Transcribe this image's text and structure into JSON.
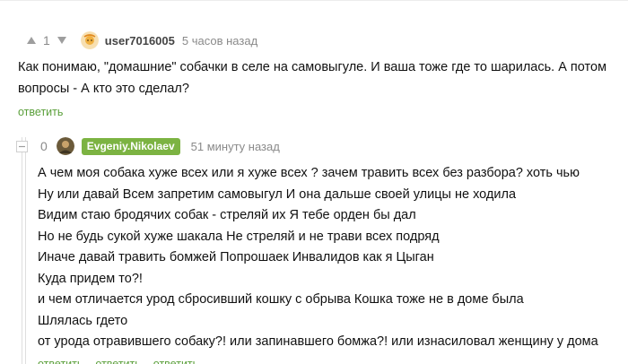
{
  "comment1": {
    "score": "1",
    "username": "user7016005",
    "time": "5 часов назад",
    "lines": [
      "Как понимаю, \"домашние\" собачки в селе на самовыгуле. И ваша тоже где то шарилась. А потом",
      "вопросы - А кто это сделал?"
    ],
    "reply_label": "ответить"
  },
  "comment2": {
    "score": "0",
    "username": "Evgeniy.Nikolaev",
    "time": "51 минуту назад",
    "lines": [
      "А чем моя собака хуже всех или я хуже всех ? зачем травить всех без разбора? хоть чью",
      "Ну или давай Всем запретим самовыгул И она дальше своей улицы не ходила",
      "Видим стаю бродячих собак - стреляй их Я тебе орден бы дал",
      "Но не будь сукой хуже шакала Не стреляй и не трави всех подряд",
      "Иначе давай травить бомжей Попрошаек Инвалидов как я Цыган",
      "Куда придем то?!",
      "и чем отличается урод сбросивший кошку с обрыва Кошка тоже не в доме была",
      "Шлялась гдето",
      "от урода отравившего собаку?! или запинавшего бомжа?! или изнасиловал женщину у дома"
    ],
    "actions": [
      "ответить",
      "ответить",
      "ответить"
    ],
    "badge_color": "#7cb342"
  },
  "colors": {
    "accent": "#5a9f3a",
    "muted": "#8a8a8a"
  }
}
